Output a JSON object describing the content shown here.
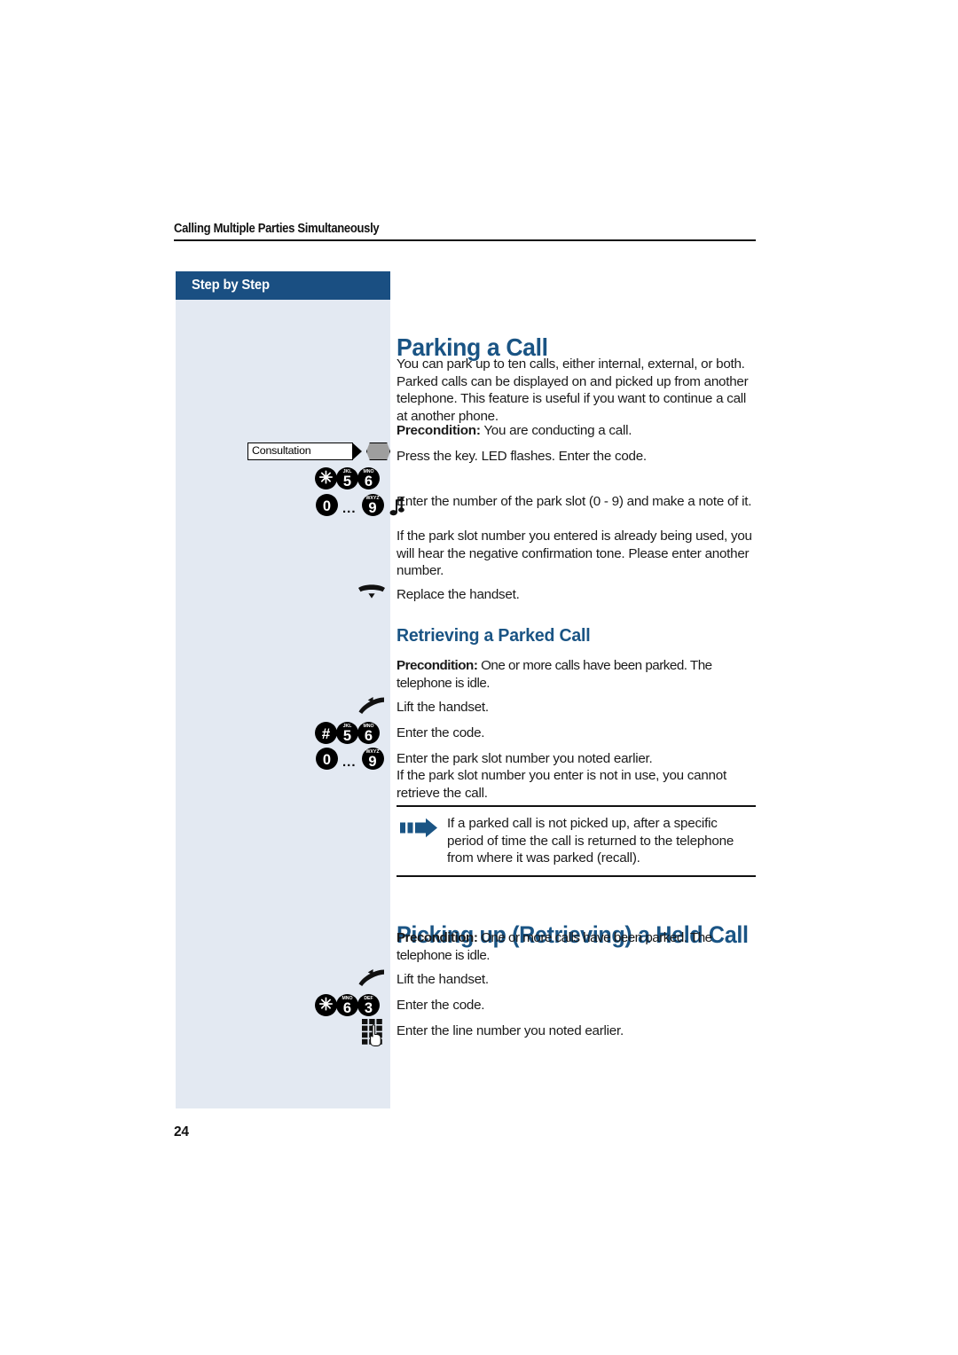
{
  "page": {
    "running_header": "Calling Multiple Parties Simultaneously",
    "page_number": "24",
    "accent_color": "#1a5484",
    "header_bar_color": "#1a4f82",
    "sidebar_color": "#e3e9f2"
  },
  "sidebar": {
    "header_label": "Step by Step"
  },
  "sections": {
    "parking": {
      "title": "Parking a Call",
      "intro": "You can park up to ten calls, either internal, external, or both. Parked calls can be displayed on and picked up from another telephone. This feature is useful if you want to continue a call at another phone.",
      "precondition_label": "Precondition:",
      "precondition_text": " You are conducting a call.",
      "step_press_key": "Press the key. LED flashes. Enter the code.",
      "step_enter_slot": "Enter the number of the park slot (0 - 9) and make a note of it.",
      "step_enter_slot_note": "If the park slot number you entered is already being used, you will hear the negative confirmation tone. Please enter another number.",
      "step_replace_handset": "Replace the handset."
    },
    "retrieving_parked": {
      "title": "Retrieving a Parked Call",
      "precondition_label": "Precondition:",
      "precondition_text": " One or more calls have been parked. The telephone is idle.",
      "step_lift_handset": "Lift the handset.",
      "step_enter_code": "Enter the code.",
      "step_enter_slot": "Enter the park slot number you noted earlier.",
      "step_enter_slot_note": "If the park slot number you enter is not in use, you cannot retrieve the call."
    },
    "note": {
      "text": "If a parked call is not picked up, after a specific period of time the call is returned to the telephone from where it was parked (recall)."
    },
    "picking_up_held": {
      "title": "Picking up (Retrieving) a Held Call",
      "precondition_label": "Precondition:",
      "precondition_text": " One or more calls have been parked. The telephone is idle.",
      "step_lift_handset": "Lift the handset.",
      "step_enter_code": "Enter the code.",
      "step_enter_line": "Enter the line number you noted earlier."
    }
  },
  "icons": {
    "consultation_key_label": "Consultation",
    "keys": {
      "star": "✳",
      "hash": "#",
      "five": "5",
      "five_letters": "JKL",
      "six": "6",
      "six_letters": "MNO",
      "three": "3",
      "three_letters": "DEF",
      "zero": "0",
      "nine": "9",
      "nine_letters": "WXYZ",
      "range_separator": "..."
    }
  }
}
